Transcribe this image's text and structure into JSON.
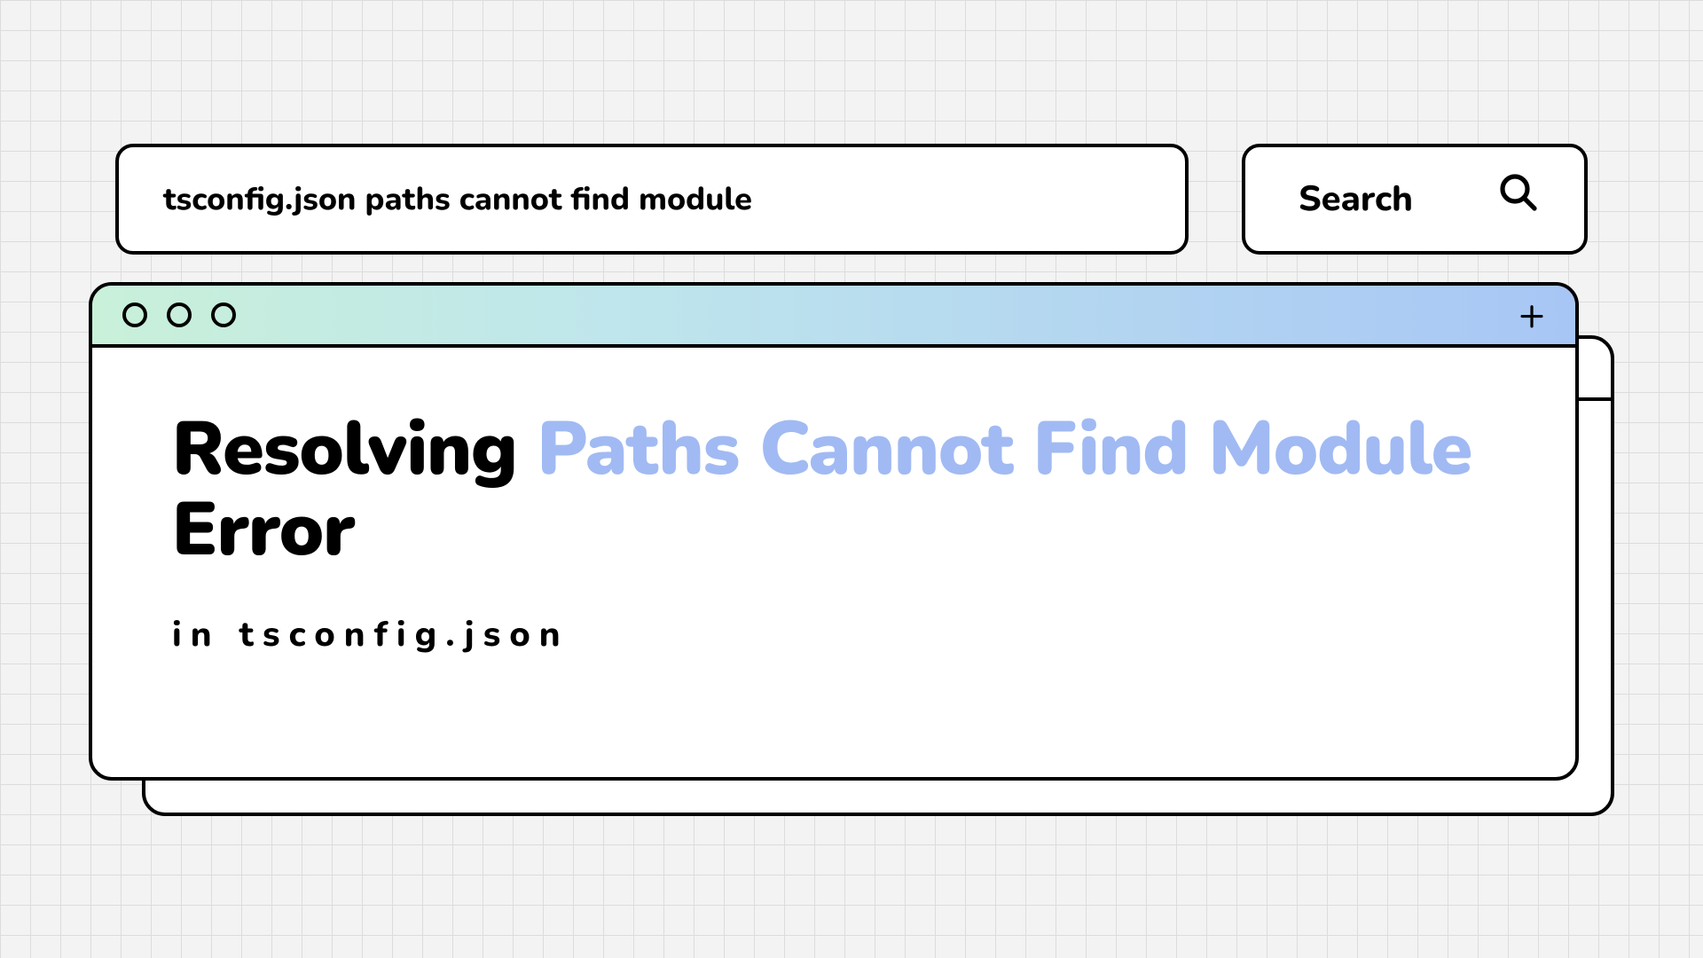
{
  "search": {
    "query": "tsconfig.json paths cannot find module",
    "button_label": "Search"
  },
  "headline": {
    "pre": "Resolving ",
    "highlight": "Paths Cannot Find Module",
    "post": " Error"
  },
  "subhead": "in tsconfig.json"
}
